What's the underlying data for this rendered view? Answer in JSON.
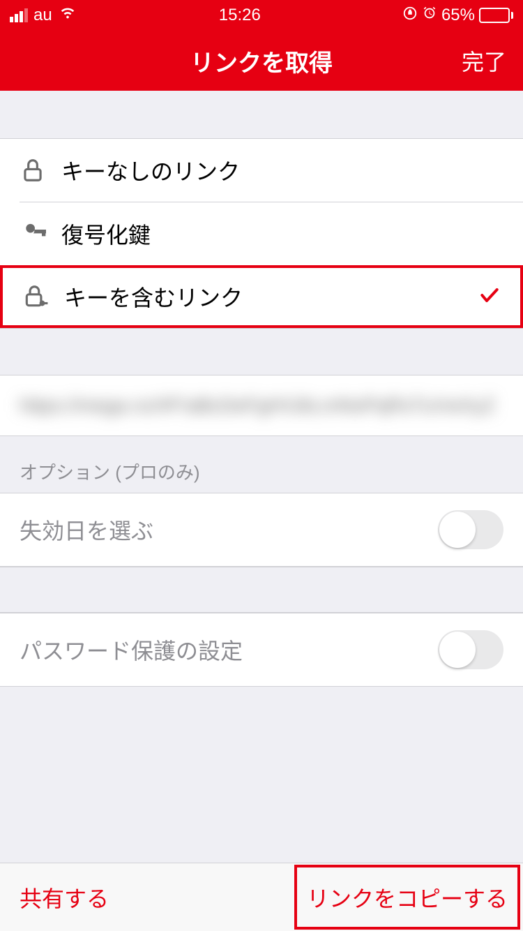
{
  "statusBar": {
    "carrier": "au",
    "time": "15:26",
    "battery": "65%"
  },
  "nav": {
    "title": "リンクを取得",
    "done": "完了"
  },
  "options": [
    {
      "label": "キーなしのリンク"
    },
    {
      "label": "復号化鍵"
    },
    {
      "label": "キーを含むリンク"
    }
  ],
  "linkPreview": "https://mega.nz/#F!aBcDeFgH!iJkLmNoPqRsTuVwXyZ",
  "proSection": {
    "header": "オプション (プロのみ)",
    "expiry": "失効日を選ぶ",
    "password": "パスワード保護の設定"
  },
  "bottomBar": {
    "share": "共有する",
    "copy": "リンクをコピーする"
  }
}
